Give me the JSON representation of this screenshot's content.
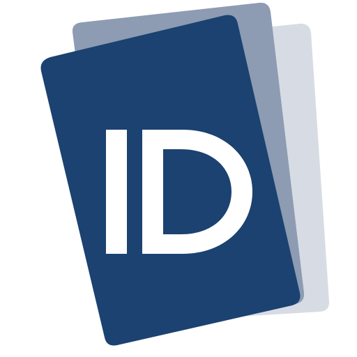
{
  "logo": {
    "name": "id-cards-logo",
    "letters": "ID",
    "colors": {
      "front_card": "#1b4270",
      "middle_card": "#8d9cb2",
      "back_card": "#d7dce4",
      "letters": "#ffffff",
      "background": "#ffffff"
    }
  }
}
